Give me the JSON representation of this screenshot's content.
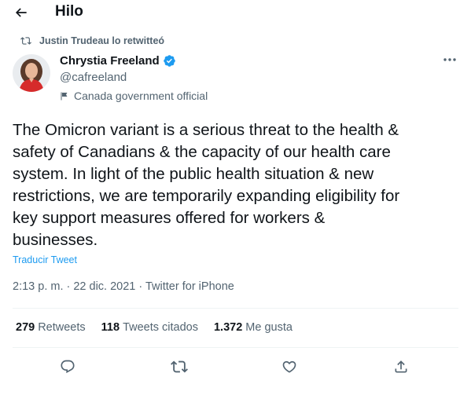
{
  "header": {
    "title": "Hilo",
    "back_icon": "arrow-left-icon"
  },
  "retweet": {
    "text": "Justin Trudeau lo retwitteó",
    "icon": "retweet-icon"
  },
  "author": {
    "name": "Chrystia Freeland",
    "handle": "@cafreeland",
    "label": "Canada government official",
    "verified_icon": "verified-badge-icon",
    "flag_icon": "flag-icon"
  },
  "tweet": {
    "text": "The Omicron variant is a serious threat to the health &\nsafety of Canadians & the capacity of our health care\nsystem. In light of the public health situation & new\nrestrictions, we are temporarily expanding eligibility for\nkey support measures offered for workers &\nbusinesses.",
    "translate_label": "Traducir Tweet",
    "meta": "2:13 p. m. · 22 dic. 2021 · Twitter for iPhone"
  },
  "stats": [
    {
      "num": "279",
      "label": "Retweets"
    },
    {
      "num": "118",
      "label": "Tweets citados"
    },
    {
      "num": "1.372",
      "label": "Me gusta"
    }
  ],
  "actions": [
    "reply-icon",
    "retweet-icon",
    "like-icon",
    "share-icon"
  ],
  "colors": {
    "accent": "#1d9bf0",
    "text": "#0f1419",
    "secondary": "#536471",
    "divider": "#eff3f4"
  }
}
